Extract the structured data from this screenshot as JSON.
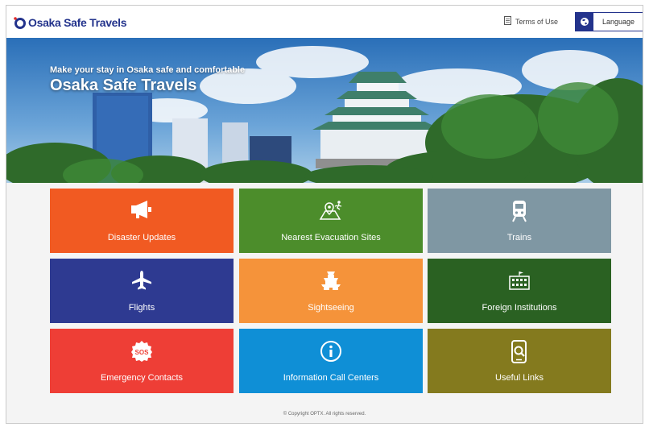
{
  "header": {
    "logo_text": "Osaka Safe Travels",
    "terms_label": "Terms of Use",
    "language_label": "Language"
  },
  "hero": {
    "subtitle": "Make your stay in Osaka safe and comfortable",
    "title": "Osaka Safe Travels"
  },
  "tiles": [
    {
      "label": "Disaster Updates",
      "color": "#f15a22",
      "icon": "megaphone-icon"
    },
    {
      "label": "Nearest Evacuation Sites",
      "color": "#4c8d2b",
      "icon": "evacuation-map-icon"
    },
    {
      "label": "Trains",
      "color": "#7f97a3",
      "icon": "train-icon"
    },
    {
      "label": "Flights",
      "color": "#2e3a91",
      "icon": "airplane-icon"
    },
    {
      "label": "Sightseeing",
      "color": "#f5933a",
      "icon": "castle-icon"
    },
    {
      "label": "Foreign Institutions",
      "color": "#2a6122",
      "icon": "embassy-icon"
    },
    {
      "label": "Emergency Contacts",
      "color": "#ee3e36",
      "icon": "sos-icon"
    },
    {
      "label": "Information Call Centers",
      "color": "#0f8fd6",
      "icon": "info-icon"
    },
    {
      "label": "Useful Links",
      "color": "#847a1e",
      "icon": "phone-search-icon"
    }
  ],
  "footer": {
    "copyright": "© Copyright OPTX. All rights reserved."
  }
}
